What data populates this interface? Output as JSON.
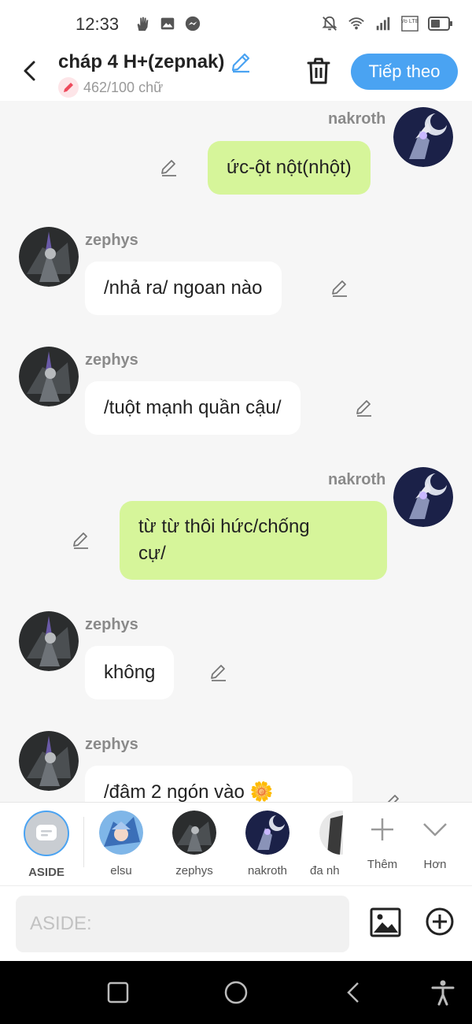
{
  "status_bar": {
    "time": "12:33",
    "left_icons": [
      "hand-icon",
      "image-icon",
      "messenger-icon"
    ],
    "right_icons": [
      "mute-bell-icon",
      "wifi-icon",
      "signal-icon",
      "volte-icon",
      "battery-icon"
    ],
    "volte_text": "Vo LTE"
  },
  "header": {
    "title": "cháp 4 H+(zepnak)",
    "word_count": "462/100 chữ",
    "next_label": "Tiếp theo",
    "accent_color": "#4aa3f2"
  },
  "messages": [
    {
      "sender": "nakroth",
      "side": "out",
      "lines": [
        "ức-ột nột(nhột)"
      ]
    },
    {
      "sender": "zephys",
      "side": "in",
      "lines": [
        "/nhả ra/ ngoan nào"
      ]
    },
    {
      "sender": "zephys",
      "side": "in",
      "lines": [
        "/tuột mạnh quần cậu/"
      ]
    },
    {
      "sender": "nakroth",
      "side": "out",
      "lines": [
        "từ từ thôi hức/chống",
        "cự/"
      ]
    },
    {
      "sender": "zephys",
      "side": "in",
      "lines": [
        "không"
      ]
    },
    {
      "sender": "zephys",
      "side": "in",
      "lines": [
        "/đâm 2 ngón vào 🌼"
      ]
    }
  ],
  "characters": [
    {
      "label": "ASIDE",
      "selected": true
    },
    {
      "label": "elsu"
    },
    {
      "label": "zephys"
    },
    {
      "label": "nakroth"
    },
    {
      "label": "đa nh"
    }
  ],
  "char_actions": {
    "more_label": "Thêm",
    "expand_label": "Hơn"
  },
  "input": {
    "placeholder": "ASIDE:"
  },
  "nav_bar": [
    "recent-apps-icon",
    "home-icon",
    "back-icon",
    "accessibility-icon"
  ]
}
